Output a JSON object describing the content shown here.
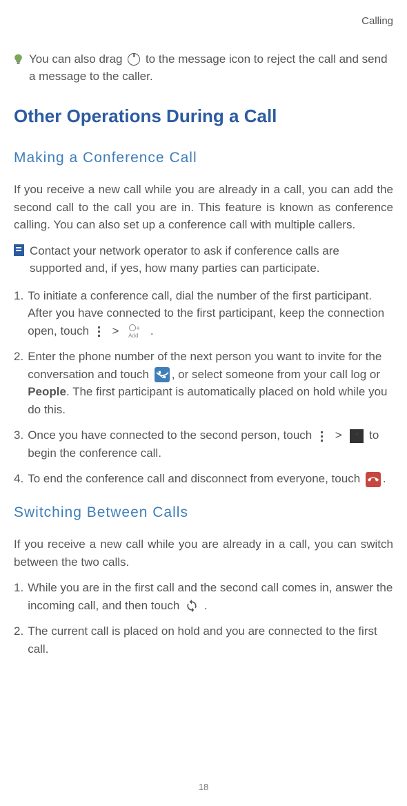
{
  "header": {
    "section": "Calling"
  },
  "tip1": {
    "text_a": "You can also drag ",
    "text_b": " to the message icon to reject the call and send a message to the caller."
  },
  "h1": "Other Operations During a Call",
  "h2_conference": "Making a Conference Call",
  "conf_intro": "If you receive a new call while you are already in a call, you can add the second call to the call you are in. This feature is known as conference calling. You can also set up a conference call with multiple callers.",
  "conf_note": "Contact your network operator to ask if conference calls are supported and, if yes, how many parties can participate.",
  "steps": {
    "s1": {
      "num": "1.",
      "a": "To initiate a conference call, dial the number of the first participant. After you have connected to the first participant, keep the connection open, touch ",
      "gt": ">",
      "b": " ."
    },
    "s2": {
      "num": "2.",
      "a": "Enter the phone number of the next person you want to invite for the conversation and touch ",
      "b": ", or select someone from your call log or ",
      "people": "People",
      "c": ". The first participant is automatically placed on hold while you do this."
    },
    "s3": {
      "num": "3.",
      "a": "Once you have connected to the second person, touch ",
      "gt": ">",
      "b": " to begin the conference call."
    },
    "s4": {
      "num": "4.",
      "a": "To end the conference call and disconnect from everyone, touch ",
      "b": "."
    }
  },
  "h2_switch": "Switching Between Calls",
  "switch_intro": "If you receive a new call while you are already in a call, you can switch between the two calls.",
  "switch_steps": {
    "s1": {
      "num": "1.",
      "a": "While you are in the first call and the second call comes in, answer the incoming call, and then touch ",
      "b": " ."
    },
    "s2": {
      "num": "2.",
      "a": "The current call is placed on hold and you are connected to the first call."
    }
  },
  "page_number": "18"
}
